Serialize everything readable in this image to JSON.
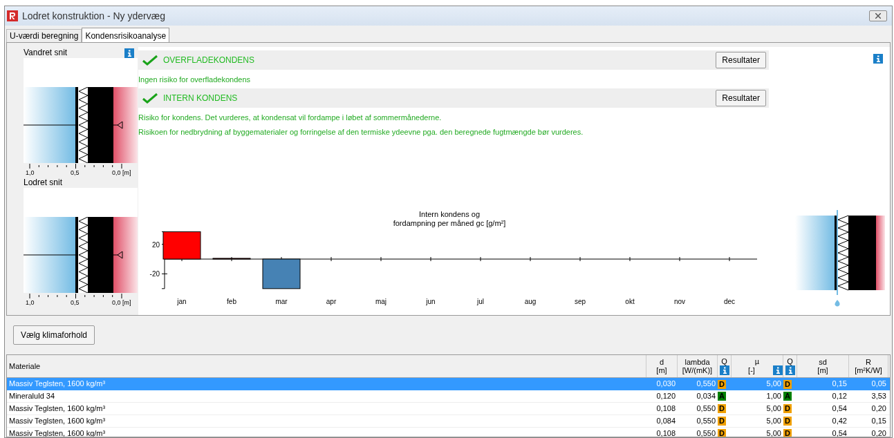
{
  "window": {
    "title": "Lodret konstruktion - Ny ydervæg"
  },
  "tabs": [
    {
      "label": "U-værdi beregning",
      "selected": false
    },
    {
      "label": "Kondensrisikoanalyse",
      "selected": true
    }
  ],
  "sections_left": [
    {
      "title": "Vandret snit",
      "scale": [
        "1,0",
        "0,5",
        "0,0 [m]"
      ]
    },
    {
      "title": "Lodret snit",
      "scale": [
        "1,0",
        "0,5",
        "0,0 [m]"
      ]
    }
  ],
  "checks": [
    {
      "title": "OVERFLADEKONDENS",
      "ok": true,
      "button": "Resultater",
      "messages": [
        "Ingen risiko for overfladekondens"
      ]
    },
    {
      "title": "INTERN KONDENS",
      "ok": true,
      "button": "Resultater",
      "messages": [
        "Risiko for kondens. Det vurderes, at kondensat vil fordampe i løbet af sommermånederne.",
        "Risikoen for nedbrydning af byggematerialer og forringelse af den termiske ydeevne pga. den beregnede fugtmængde bør vurderes."
      ]
    }
  ],
  "chart_data": {
    "type": "bar",
    "title": "Intern kondens og fordampning per måned gc [g/m²]",
    "categories": [
      "jan",
      "feb",
      "mar",
      "apr",
      "maj",
      "jun",
      "jul",
      "aug",
      "sep",
      "okt",
      "nov",
      "dec"
    ],
    "values": [
      37,
      1,
      -40,
      0,
      0,
      0,
      0,
      0,
      0,
      0,
      0,
      0
    ],
    "ylim": [
      -40,
      37
    ],
    "yticks": [
      20,
      -20
    ]
  },
  "climate_button": "Vælg klimaforhold",
  "table": {
    "columns": [
      {
        "label": "Materiale"
      },
      {
        "label": "d",
        "unit": "[m]"
      },
      {
        "label": "lambda",
        "unit": "[W/(mK)]"
      },
      {
        "label": "Q",
        "info": true
      },
      {
        "label": "µ",
        "unit": "[-]",
        "info": true
      },
      {
        "label": "Q",
        "info": true
      },
      {
        "label": "sd",
        "unit": "[m]"
      },
      {
        "label": "R",
        "unit": "[m²K/W]"
      }
    ],
    "rows": [
      {
        "selected": true,
        "material": "Massiv Teglsten, 1600 kg/m³",
        "d": "0,030",
        "lambda": "0,550",
        "q1": {
          "label": "D",
          "color": "#f0a000"
        },
        "mu": "5,00",
        "q2": {
          "label": "D",
          "color": "#f0a000"
        },
        "sd": "0,15",
        "r": "0,05"
      },
      {
        "selected": false,
        "material": "Mineraluld 34",
        "d": "0,120",
        "lambda": "0,034",
        "q1": {
          "label": "A",
          "color": "#008000"
        },
        "mu": "1,00",
        "q2": {
          "label": "A",
          "color": "#008000"
        },
        "sd": "0,12",
        "r": "3,53"
      },
      {
        "selected": false,
        "material": "Massiv Teglsten, 1600 kg/m³",
        "d": "0,108",
        "lambda": "0,550",
        "q1": {
          "label": "D",
          "color": "#f0a000"
        },
        "mu": "5,00",
        "q2": {
          "label": "D",
          "color": "#f0a000"
        },
        "sd": "0,54",
        "r": "0,20"
      },
      {
        "selected": false,
        "material": "Massiv Teglsten, 1600 kg/m³",
        "d": "0,084",
        "lambda": "0,550",
        "q1": {
          "label": "D",
          "color": "#f0a000"
        },
        "mu": "5,00",
        "q2": {
          "label": "D",
          "color": "#f0a000"
        },
        "sd": "0,42",
        "r": "0,15"
      },
      {
        "selected": false,
        "material": "Massiv Teglsten, 1600 kg/m³",
        "d": "0,108",
        "lambda": "0,550",
        "q1": {
          "label": "D",
          "color": "#f0a000"
        },
        "mu": "5,00",
        "q2": {
          "label": "D",
          "color": "#f0a000"
        },
        "sd": "0,54",
        "r": "0,20"
      }
    ]
  }
}
